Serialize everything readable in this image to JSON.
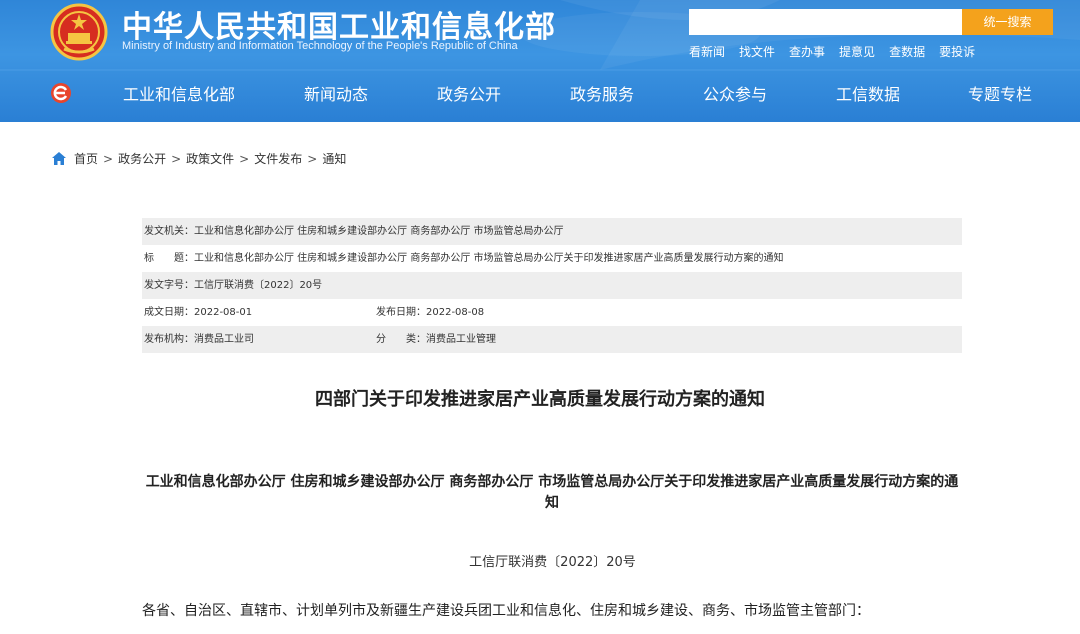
{
  "header": {
    "title": "中华人民共和国工业和信息化部",
    "subtitle": "Ministry of Industry and Information Technology of the People's Republic of China",
    "search": {
      "placeholder": "",
      "button_label": "统一搜索"
    },
    "quick_links": [
      "看新闻",
      "找文件",
      "查办事",
      "提意见",
      "查数据",
      "要投诉"
    ],
    "nav": [
      "工业和信息化部",
      "新闻动态",
      "政务公开",
      "政务服务",
      "公众参与",
      "工信数据",
      "专题专栏"
    ]
  },
  "breadcrumb": [
    "首页",
    "政务公开",
    "政策文件",
    "文件发布",
    "通知"
  ],
  "meta": {
    "issuer": "发文机关：工业和信息化部办公厅 住房和城乡建设部办公厅 商务部办公厅 市场监管总局办公厅",
    "title": "标　　题：工业和信息化部办公厅 住房和城乡建设部办公厅 商务部办公厅 市场监管总局办公厅关于印发推进家居产业高质量发展行动方案的通知",
    "doc_no": "发文字号：工信厅联消费〔2022〕20号",
    "created": "成文日期：2022-08-01",
    "published": "发布日期：2022-08-08",
    "agency": "发布机构：消费品工业司",
    "category": "分　　类：消费品工业管理"
  },
  "article": {
    "title": "四部门关于印发推进家居产业高质量发展行动方案的通知",
    "subtitle": "工业和信息化部办公厅 住房和城乡建设部办公厅 商务部办公厅 市场监管总局办公厅关于印发推进家居产业高质量发展行动方案的通知",
    "number": "工信厅联消费〔2022〕20号",
    "salutation": "各省、自治区、直辖市、计划单列市及新疆生产建设兵团工业和信息化、住房和城乡建设、商务、市场监管主管部门："
  },
  "colors": {
    "header_blue": "#2f86d8",
    "search_button": "#f4a21c",
    "meta_row_shade": "#eeeeee"
  }
}
